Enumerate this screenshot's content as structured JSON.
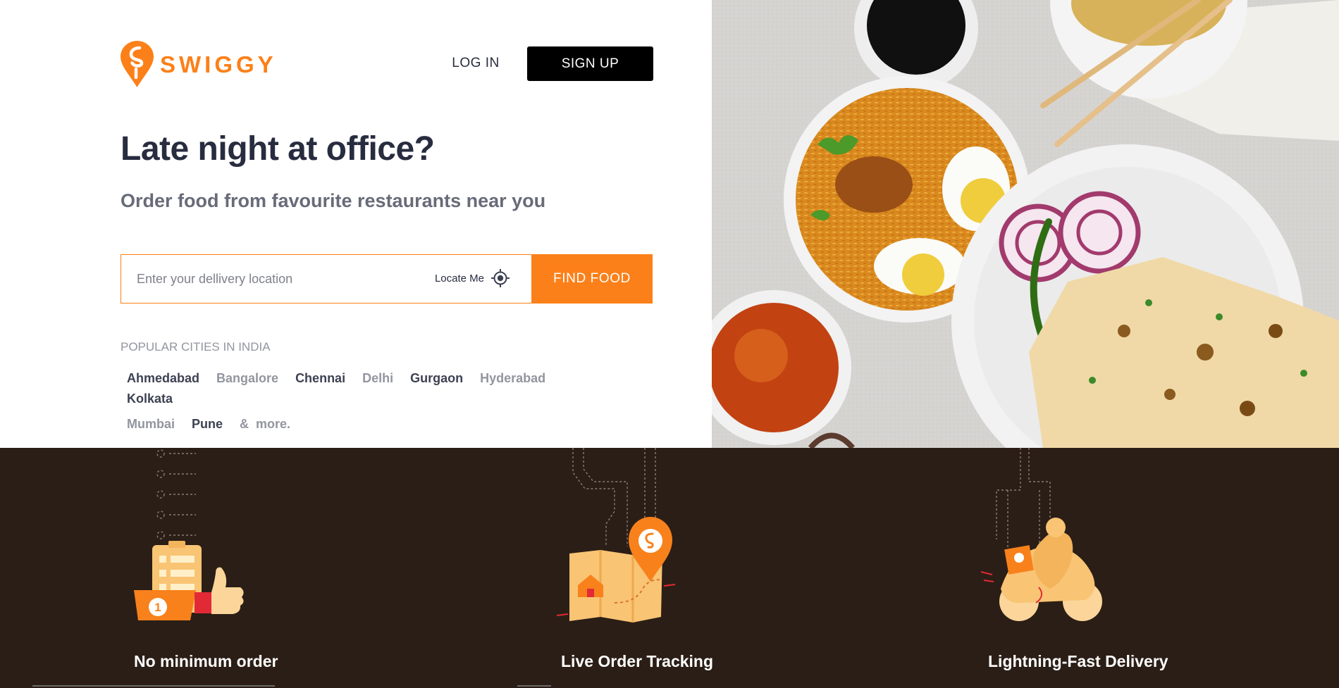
{
  "brand": {
    "name": "SWIGGY",
    "color": "#fc8019"
  },
  "header": {
    "login_label": "LOG IN",
    "signup_label": "SIGN UP"
  },
  "hero": {
    "headline": "Late night at office?",
    "subheadline": "Order food from favourite restaurants near you"
  },
  "search": {
    "placeholder": "Enter your dellivery location",
    "value": "",
    "locate_label": "Locate Me",
    "locate_icon": "crosshair-icon",
    "find_label": "FIND FOOD"
  },
  "cities": {
    "heading": "POPULAR CITIES IN INDIA",
    "items": [
      {
        "label": "Ahmedabad",
        "muted": false
      },
      {
        "label": "Bangalore",
        "muted": true
      },
      {
        "label": "Chennai",
        "muted": false
      },
      {
        "label": "Delhi",
        "muted": true
      },
      {
        "label": "Gurgaon",
        "muted": false
      },
      {
        "label": "Hyderabad",
        "muted": true
      },
      {
        "label": "Kolkata",
        "muted": false
      },
      {
        "label": "Mumbai",
        "muted": true
      },
      {
        "label": "Pune",
        "muted": false
      }
    ],
    "and_label": "&",
    "more_label": "more."
  },
  "hero_image": {
    "icon": "food-photo"
  },
  "features": [
    {
      "title": "No minimum order",
      "icon": "thumbs-up-checklist-icon"
    },
    {
      "title": "Live Order Tracking",
      "icon": "map-pin-tracking-icon"
    },
    {
      "title": "Lightning-Fast Delivery",
      "icon": "delivery-scooter-icon"
    }
  ],
  "colors": {
    "accent": "#fc8019",
    "dark_band": "#2b1e16",
    "heading": "#282c3f",
    "muted": "#93959f"
  }
}
